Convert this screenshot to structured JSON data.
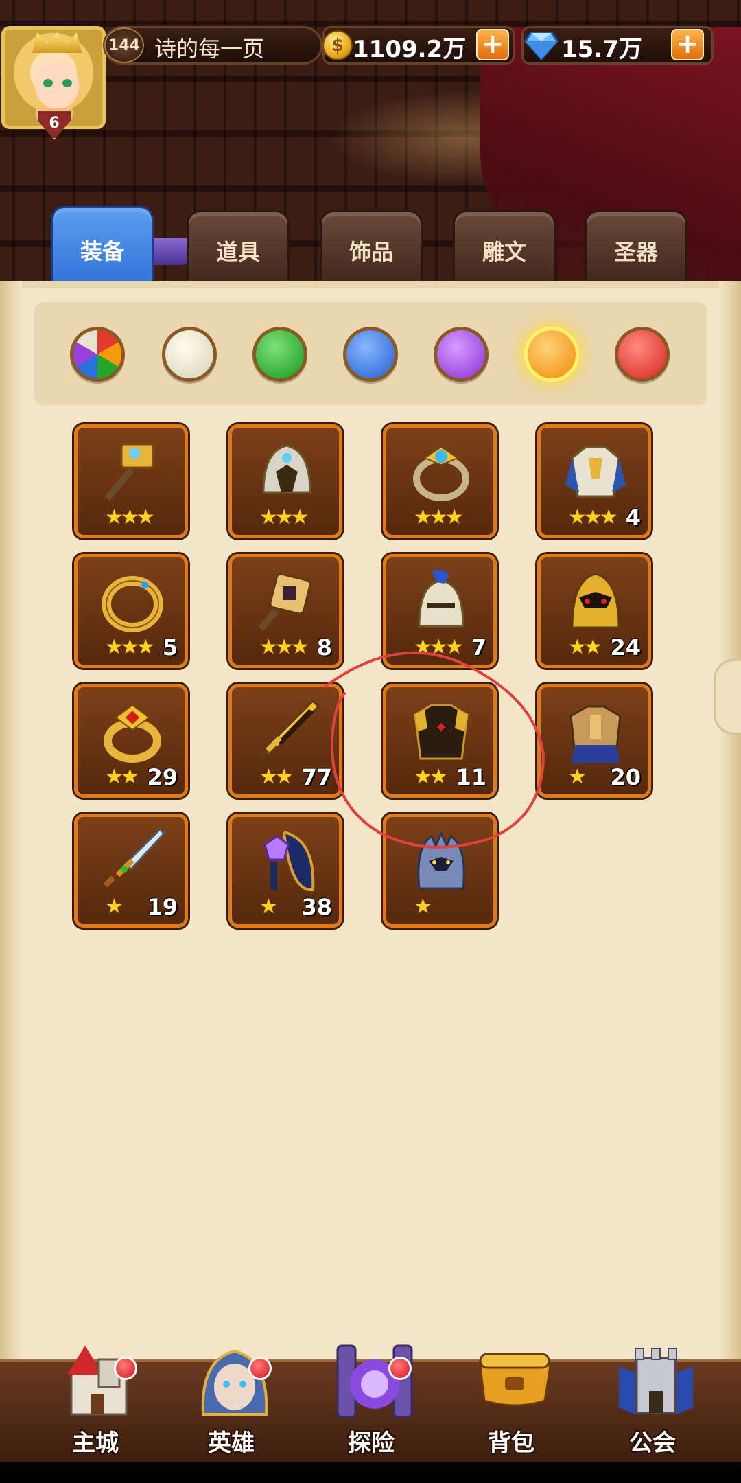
{
  "player": {
    "level": "144",
    "name": "诗的每一页",
    "vip_level": "6"
  },
  "currency": {
    "gold": "1109.2万",
    "gems": "15.7万",
    "plus": "+"
  },
  "tabs": [
    {
      "label": "装备",
      "active": true
    },
    {
      "label": "道具",
      "active": false
    },
    {
      "label": "饰品",
      "active": false
    },
    {
      "label": "雕文",
      "active": false
    },
    {
      "label": "圣器",
      "active": false
    }
  ],
  "color_filters": [
    {
      "name": "all",
      "color": "multi",
      "selected": false
    },
    {
      "name": "white",
      "color": "#e9e4d0",
      "selected": false
    },
    {
      "name": "green",
      "color": "#23a52a",
      "selected": false
    },
    {
      "name": "blue",
      "color": "#2c6fe0",
      "selected": false
    },
    {
      "name": "purple",
      "color": "#9b3fdc",
      "selected": false
    },
    {
      "name": "orange",
      "color": "#f59a0c",
      "selected": true
    },
    {
      "name": "red",
      "color": "#e23a2c",
      "selected": false
    }
  ],
  "items": [
    {
      "icon": "hammer-icon",
      "stars": "★★★",
      "count": ""
    },
    {
      "icon": "helmet-icon",
      "stars": "★★★",
      "count": ""
    },
    {
      "icon": "ring-icon",
      "stars": "★★★",
      "count": ""
    },
    {
      "icon": "armor-icon",
      "stars": "★★★",
      "count": "4"
    },
    {
      "icon": "snake-ring-icon",
      "stars": "★★★",
      "count": "5"
    },
    {
      "icon": "cube-hammer-icon",
      "stars": "★★★",
      "count": "8"
    },
    {
      "icon": "knight-helmet-icon",
      "stars": "★★★",
      "count": "7"
    },
    {
      "icon": "gold-helmet-icon",
      "stars": "★★",
      "count": "24"
    },
    {
      "icon": "ruby-ring-icon",
      "stars": "★★",
      "count": "29"
    },
    {
      "icon": "sword-icon",
      "stars": "★★",
      "count": "77"
    },
    {
      "icon": "chest-armor-icon",
      "stars": "★★",
      "count": "11"
    },
    {
      "icon": "plate-armor-icon",
      "stars": "★",
      "count": "20"
    },
    {
      "icon": "dagger-icon",
      "stars": "★",
      "count": "19"
    },
    {
      "icon": "gem-shield-icon",
      "stars": "★",
      "count": "38"
    },
    {
      "icon": "wolf-helmet-icon",
      "stars": "★",
      "count": ""
    }
  ],
  "bottom_nav": [
    {
      "label": "主城",
      "icon": "castle-icon",
      "badge": true
    },
    {
      "label": "英雄",
      "icon": "hero-icon",
      "badge": true
    },
    {
      "label": "探险",
      "icon": "portal-icon",
      "badge": true
    },
    {
      "label": "背包",
      "icon": "backpack-icon",
      "badge": false
    },
    {
      "label": "公会",
      "icon": "guild-tower-icon",
      "badge": false
    }
  ],
  "colors": {
    "tab_active": "#3f82e4",
    "card_border": "#e07a17",
    "annotation": "#e0413c"
  }
}
